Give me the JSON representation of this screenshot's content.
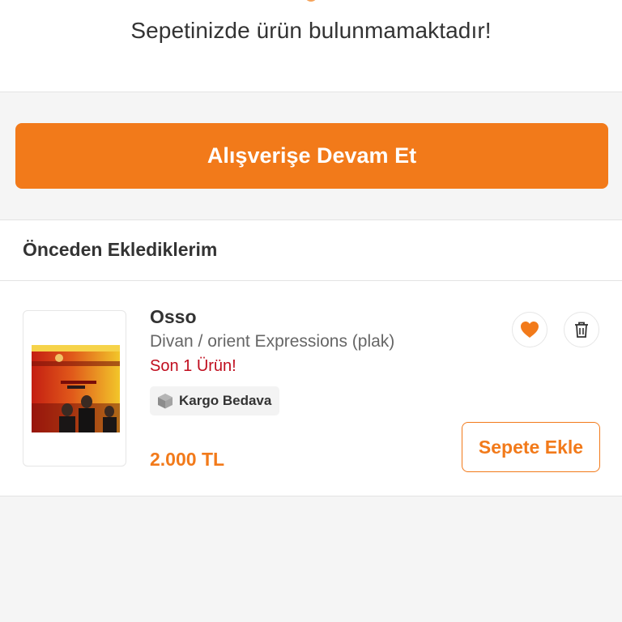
{
  "cart": {
    "empty_message": "Sepetinizde ürün bulunmamaktadır!",
    "continue_button": "Alışverişe Devam Et"
  },
  "previously_added": {
    "title": "Önceden Eklediklerim",
    "items": [
      {
        "name": "Osso",
        "subtitle": "Divan / orient Expressions (plak)",
        "stock": "Son 1 Ürün!",
        "badge": "Kargo Bedava",
        "badge_icon": "package-box-icon",
        "price": "2.000 TL",
        "add_button": "Sepete Ekle",
        "favorite_icon": "heart-icon",
        "delete_icon": "trash-icon"
      }
    ]
  },
  "colors": {
    "accent": "#f27a1a",
    "stock_red": "#c00d1e",
    "background": "#f5f5f5"
  }
}
